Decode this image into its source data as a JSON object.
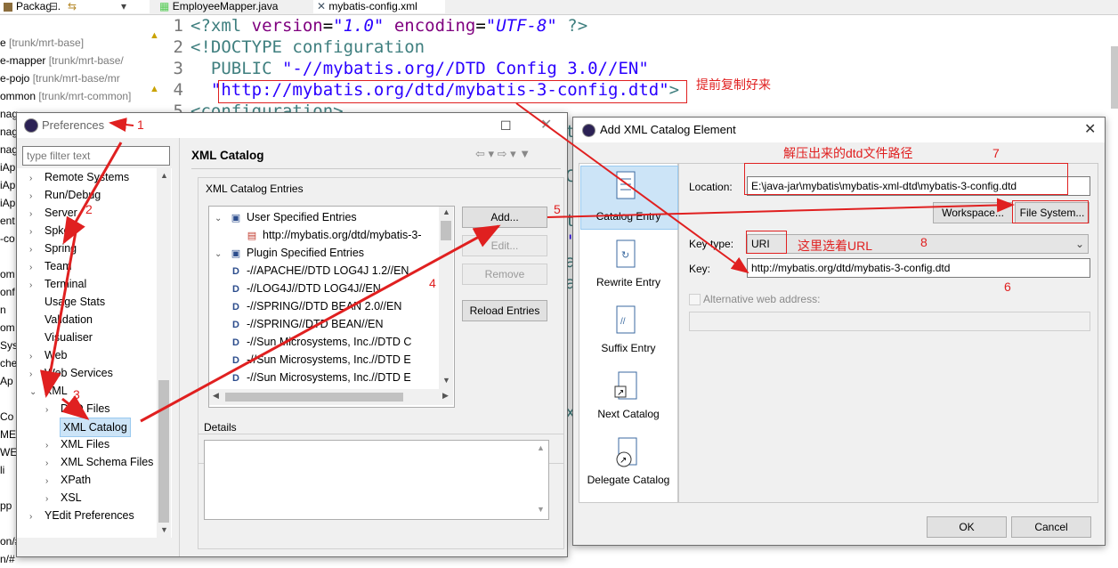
{
  "ide": {
    "tabs": [
      {
        "label": "Packag..."
      },
      {
        "label": "EmployeeMapper.java"
      },
      {
        "label": "mybatis-config.xml"
      }
    ],
    "package_tree": [
      {
        "name": "e ",
        "deco": "[trunk/mrt-base]"
      },
      {
        "name": "e-mapper ",
        "deco": "[trunk/mrt-base/"
      },
      {
        "name": "e-pojo ",
        "deco": "[trunk/mrt-base/mr"
      },
      {
        "name": "ommon ",
        "deco": "[trunk/mrt-common]"
      },
      {
        "name": "nag",
        "deco": ""
      },
      {
        "name": "nag",
        "deco": ""
      },
      {
        "name": "nag",
        "deco": ""
      },
      {
        "name": "iAp",
        "deco": ""
      },
      {
        "name": "iAp",
        "deco": ""
      },
      {
        "name": "iAp",
        "deco": ""
      },
      {
        "name": "ent",
        "deco": ""
      },
      {
        "name": "-co",
        "deco": ""
      },
      {
        "name": "",
        "deco": ""
      },
      {
        "name": "om",
        "deco": ""
      },
      {
        "name": "onf",
        "deco": ""
      },
      {
        "name": "n",
        "deco": ""
      },
      {
        "name": "om",
        "deco": ""
      },
      {
        "name": "Sys",
        "deco": ""
      },
      {
        "name": "che",
        "deco": ""
      },
      {
        "name": "Ap",
        "deco": ""
      },
      {
        "name": "",
        "deco": ""
      },
      {
        "name": "Co",
        "deco": ""
      },
      {
        "name": "MET",
        "deco": ""
      },
      {
        "name": "WEB",
        "deco": ""
      },
      {
        "name": "li",
        "deco": ""
      },
      {
        "name": "",
        "deco": ""
      },
      {
        "name": "pp",
        "deco": ""
      },
      {
        "name": "",
        "deco": ""
      },
      {
        "name": "on/#",
        "deco": ""
      },
      {
        "name": "n/#",
        "deco": ""
      }
    ],
    "code": {
      "line_numbers": [
        "1",
        "2",
        "3",
        "4",
        "5"
      ],
      "l1_pi_open": "<?xml ",
      "l1_attr1": "version",
      "l1_eq1": "=",
      "l1_val1": "\"1.0\"",
      "l1_attr2": " encoding",
      "l1_eq2": "=",
      "l1_val2": "\"UTF-8\"",
      "l1_pi_close": " ?>",
      "l2": "<!DOCTYPE configuration",
      "l3_public": "  PUBLIC ",
      "l3_val": "\"-//mybatis.org//DTD Config 3.0//EN\"",
      "l4_indent": "  ",
      "l4_val": "\"http://mybatis.org/dtd/mybatis-3-config.dtd\"",
      "l4_close": ">",
      "l5": "<configuration>",
      "fragment_chars": [
        "t",
        "C",
        "t",
        "'",
        "a",
        "a",
        "x"
      ]
    }
  },
  "annotations": {
    "advance_copy": "提前复制好来",
    "n1": "1",
    "n2": "2",
    "n3": "3",
    "n4": "4",
    "n5": "5",
    "n6": "6",
    "n7": "7",
    "n8": "8",
    "dtd_path_note": "解压出来的dtd文件路径",
    "choose_uri_note": "这里选着URL"
  },
  "preferences": {
    "title": "Preferences",
    "filter_placeholder": "type filter text",
    "tree": [
      {
        "label": "Remote Systems",
        "indent": 0,
        "arrow": "›"
      },
      {
        "label": "Run/Debug",
        "indent": 0,
        "arrow": "›"
      },
      {
        "label": "Server",
        "indent": 0,
        "arrow": "›"
      },
      {
        "label": "Spket",
        "indent": 0,
        "arrow": "›"
      },
      {
        "label": "Spring",
        "indent": 0,
        "arrow": "›"
      },
      {
        "label": "Team",
        "indent": 0,
        "arrow": "›"
      },
      {
        "label": "Terminal",
        "indent": 0,
        "arrow": "›"
      },
      {
        "label": "Usage Stats",
        "indent": 0,
        "arrow": ""
      },
      {
        "label": "Validation",
        "indent": 0,
        "arrow": ""
      },
      {
        "label": "Visualiser",
        "indent": 0,
        "arrow": ""
      },
      {
        "label": "Web",
        "indent": 0,
        "arrow": "›"
      },
      {
        "label": "Web Services",
        "indent": 0,
        "arrow": "›"
      },
      {
        "label": "XML",
        "indent": 0,
        "arrow": "⌄"
      },
      {
        "label": "DTD Files",
        "indent": 1,
        "arrow": "›"
      },
      {
        "label": "XML Catalog",
        "indent": 1,
        "arrow": ""
      },
      {
        "label": "XML Files",
        "indent": 1,
        "arrow": "›"
      },
      {
        "label": "XML Schema Files",
        "indent": 1,
        "arrow": "›"
      },
      {
        "label": "XPath",
        "indent": 1,
        "arrow": "›"
      },
      {
        "label": "XSL",
        "indent": 1,
        "arrow": "›"
      },
      {
        "label": "YEdit Preferences",
        "indent": 0,
        "arrow": "›"
      }
    ],
    "page_title": "XML Catalog",
    "entries_label": "XML Catalog Entries",
    "entries": [
      {
        "label": "User Specified Entries",
        "indent": 0,
        "arrow": "⌄",
        "icon": "catalog"
      },
      {
        "label": "http://mybatis.org/dtd/mybatis-3-",
        "indent": 2,
        "arrow": "",
        "icon": "dtd-file"
      },
      {
        "label": "Plugin Specified Entries",
        "indent": 0,
        "arrow": "⌄",
        "icon": "catalog"
      },
      {
        "label": "-//APACHE//DTD LOG4J 1.2//EN",
        "indent": 1,
        "arrow": "",
        "icon": "dtd"
      },
      {
        "label": "-//LOG4J//DTD LOG4J//EN",
        "indent": 1,
        "arrow": "",
        "icon": "dtd"
      },
      {
        "label": "-//SPRING//DTD BEAN 2.0//EN",
        "indent": 1,
        "arrow": "",
        "icon": "dtd"
      },
      {
        "label": "-//SPRING//DTD BEAN//EN",
        "indent": 1,
        "arrow": "",
        "icon": "dtd"
      },
      {
        "label": "-//Sun Microsystems, Inc.//DTD C",
        "indent": 1,
        "arrow": "",
        "icon": "dtd"
      },
      {
        "label": "-//Sun Microsystems, Inc.//DTD E",
        "indent": 1,
        "arrow": "",
        "icon": "dtd"
      },
      {
        "label": "-//Sun Microsystems, Inc.//DTD E",
        "indent": 1,
        "arrow": "",
        "icon": "dtd"
      }
    ],
    "buttons": {
      "add": "Add...",
      "edit": "Edit...",
      "remove": "Remove",
      "reload": "Reload Entries"
    },
    "details_label": "Details"
  },
  "add_dialog": {
    "title": "Add XML Catalog Element",
    "sidebar": [
      {
        "label": "Catalog Entry"
      },
      {
        "label": "Rewrite Entry"
      },
      {
        "label": "Suffix Entry"
      },
      {
        "label": "Next Catalog"
      },
      {
        "label": "Delegate Catalog"
      }
    ],
    "location_label": "Location:",
    "location_value": "E:\\java-jar\\mybatis\\mybatis-xml-dtd\\mybatis-3-config.dtd",
    "workspace_button": "Workspace...",
    "file_system_button": "File System...",
    "key_type_label": "Key type:",
    "key_type_value": "URI",
    "key_label": "Key:",
    "key_value": "http://mybatis.org/dtd/mybatis-3-config.dtd",
    "alt_web_label": "Alternative web address:",
    "ok": "OK",
    "cancel": "Cancel"
  }
}
